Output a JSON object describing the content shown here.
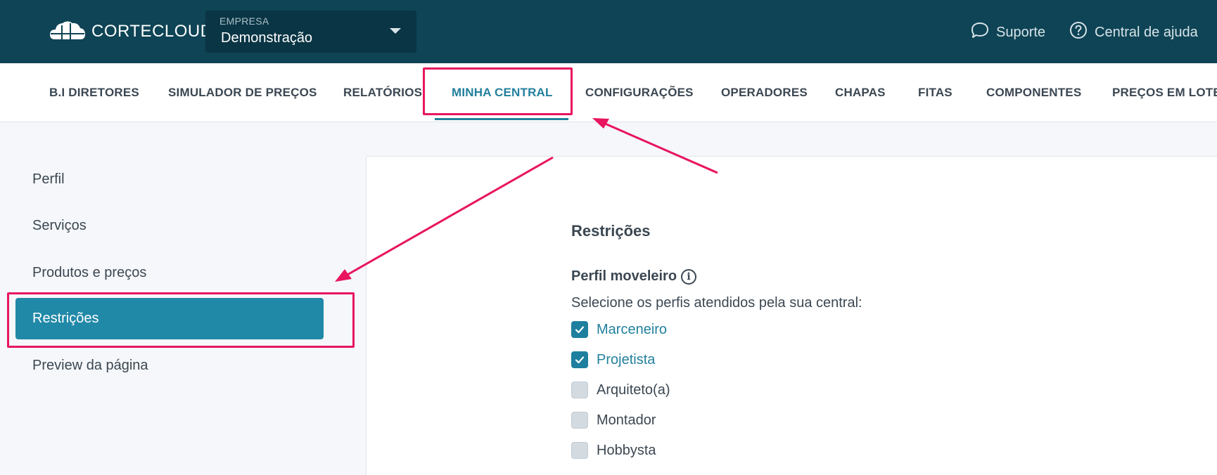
{
  "header": {
    "brand": "CORTECLOUD",
    "empresa_label": "EMPRESA",
    "empresa_value": "Demonstração",
    "support_label": "Suporte",
    "help_label": "Central de ajuda"
  },
  "nav": {
    "items": [
      {
        "label": "B.I DIRETORES"
      },
      {
        "label": "SIMULADOR DE PREÇOS"
      },
      {
        "label": "RELATÓRIOS"
      },
      {
        "label": "MINHA CENTRAL"
      },
      {
        "label": "CONFIGURAÇÕES"
      },
      {
        "label": "OPERADORES"
      },
      {
        "label": "CHAPAS"
      },
      {
        "label": "FITAS"
      },
      {
        "label": "COMPONENTES"
      },
      {
        "label": "PREÇOS EM LOTE"
      }
    ],
    "active": "MINHA CENTRAL"
  },
  "sidebar": {
    "items": [
      {
        "label": "Perfil"
      },
      {
        "label": "Serviços"
      },
      {
        "label": "Produtos e preços"
      },
      {
        "label": "Restrições"
      },
      {
        "label": "Preview da página"
      }
    ],
    "active": "Restrições"
  },
  "content": {
    "section_title": "Restrições",
    "perfil_title": "Perfil moveleiro",
    "perfil_subtitle": "Selecione os perfis atendidos pela sua central:",
    "options": [
      {
        "label": "Marceneiro",
        "checked": true
      },
      {
        "label": "Projetista",
        "checked": true
      },
      {
        "label": "Arquiteto(a)",
        "checked": false
      },
      {
        "label": "Montador",
        "checked": false
      },
      {
        "label": "Hobbysta",
        "checked": false
      }
    ]
  },
  "colors": {
    "header_bg": "#0e4455",
    "accent": "#22809d",
    "annotation": "#e8155f"
  }
}
